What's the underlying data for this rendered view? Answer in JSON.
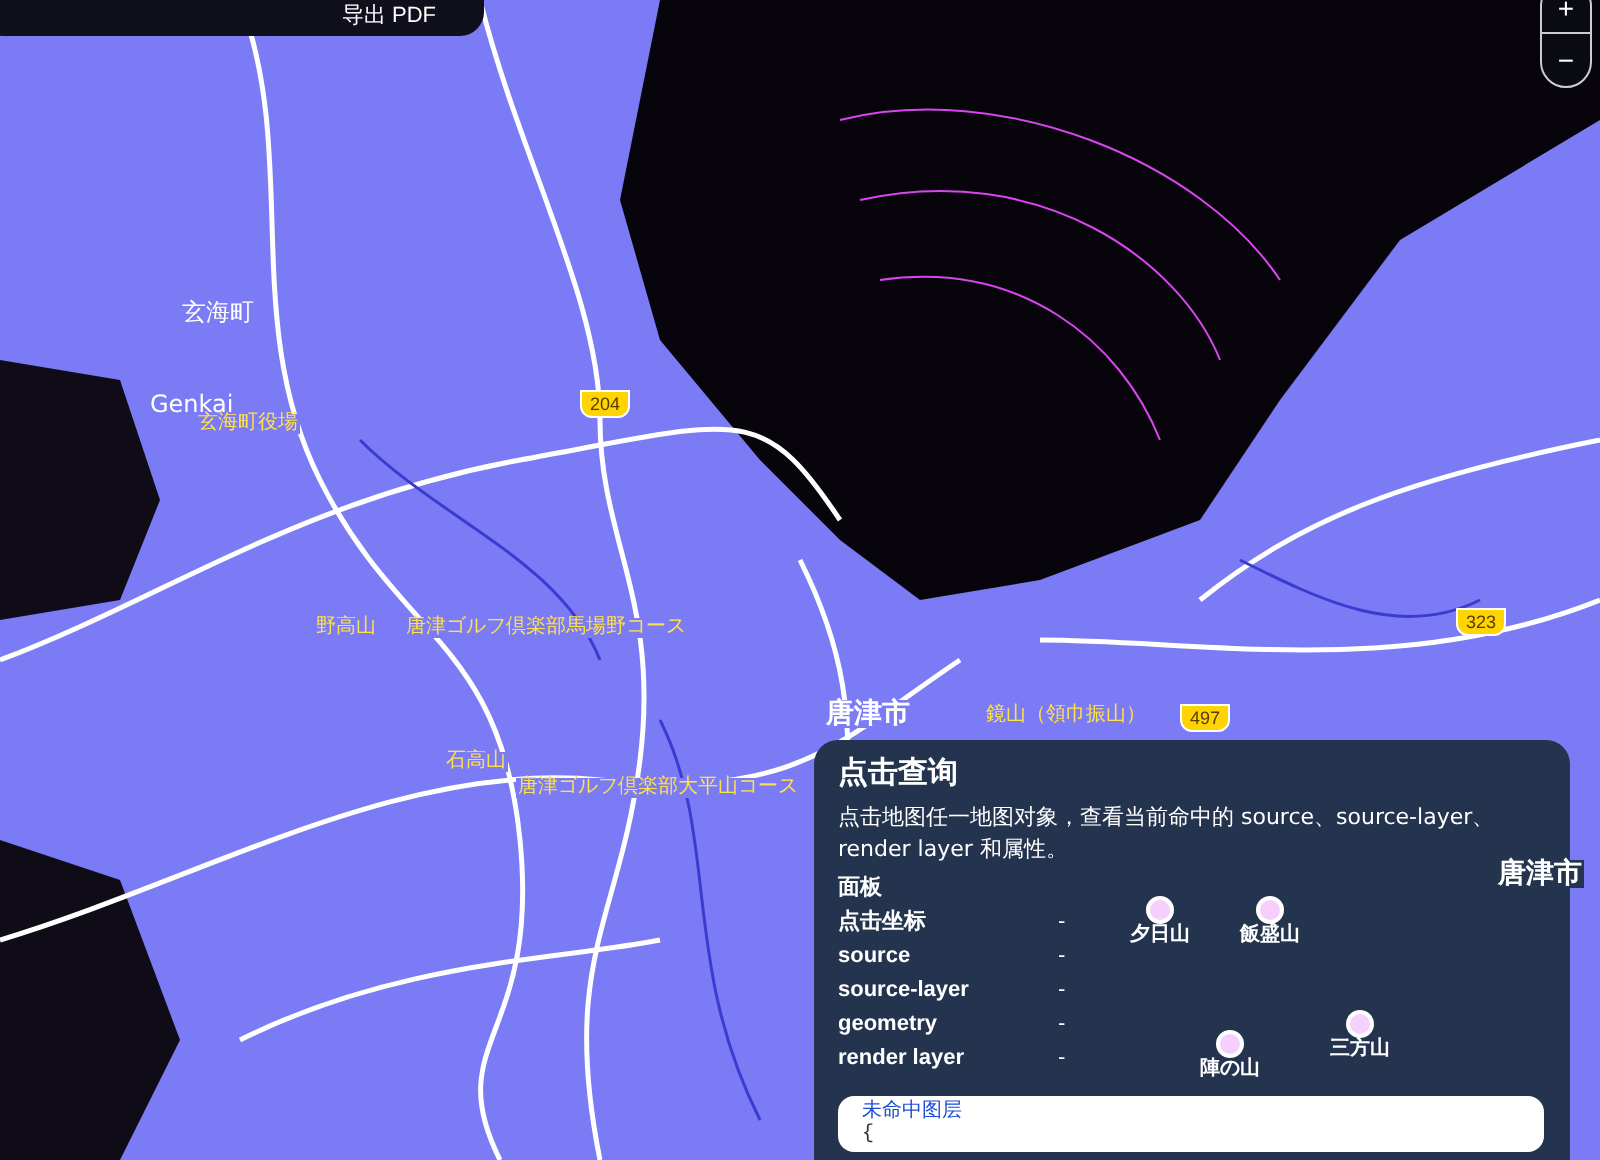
{
  "toolbar": {
    "text": "导出 PDF"
  },
  "zoom_controls": {
    "zoom_in": "+",
    "zoom_out": "−"
  },
  "map": {
    "labels": [
      {
        "text": "玄海町",
        "kind": "town"
      },
      {
        "text": "Genkai",
        "kind": "town"
      },
      {
        "text": "玄海町役場",
        "kind": "poi"
      },
      {
        "text": "野高山",
        "kind": "poi"
      },
      {
        "text": "唐津ゴルフ倶楽部馬場野コース",
        "kind": "poi"
      },
      {
        "text": "石高山",
        "kind": "poi"
      },
      {
        "text": "唐津ゴルフ倶楽部大平山コース",
        "kind": "poi"
      },
      {
        "text": "唐津市",
        "kind": "city"
      },
      {
        "text": "鏡山（領巾振山）",
        "kind": "poi"
      },
      {
        "text": "唐津市",
        "kind": "city"
      }
    ],
    "shields": [
      "204",
      "323",
      "497"
    ]
  },
  "panel": {
    "title": "点击查询",
    "description": "点击地图任一地图对象，查看当前命中的 source、source-layer、render layer 和属性。",
    "section": "面板",
    "fields": [
      {
        "label": "点击坐标",
        "value": "-"
      },
      {
        "label": "source",
        "value": "-"
      },
      {
        "label": "source-layer",
        "value": "-"
      },
      {
        "label": "geometry",
        "value": "-"
      },
      {
        "label": "render layer",
        "value": "-"
      }
    ],
    "peaks": [
      "夕日山",
      "飯盛山",
      "三方山",
      "陣の山"
    ],
    "result": {
      "status": "未命中图层",
      "code": "{"
    }
  }
}
